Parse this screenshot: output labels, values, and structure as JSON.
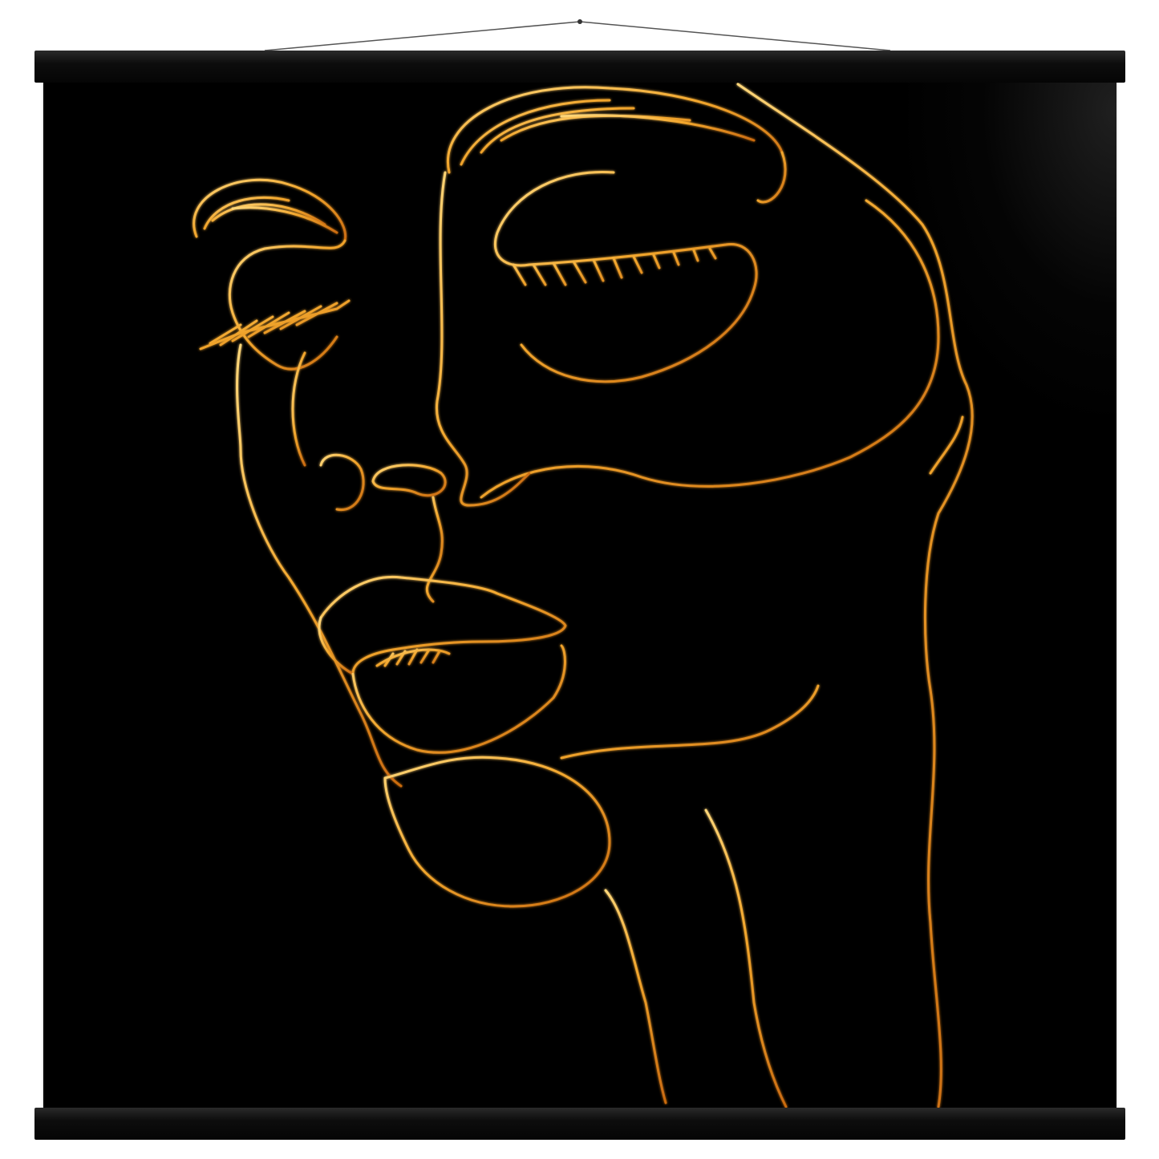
{
  "image": {
    "subject": "gold-line-face-poster",
    "colors": {
      "background": "#000000",
      "line_gold": "#f2a72e",
      "line_highlight": "#ffd77a",
      "line_shadow": "#c96a10",
      "hanger": "#0b0b0b",
      "page": "#ffffff"
    }
  }
}
